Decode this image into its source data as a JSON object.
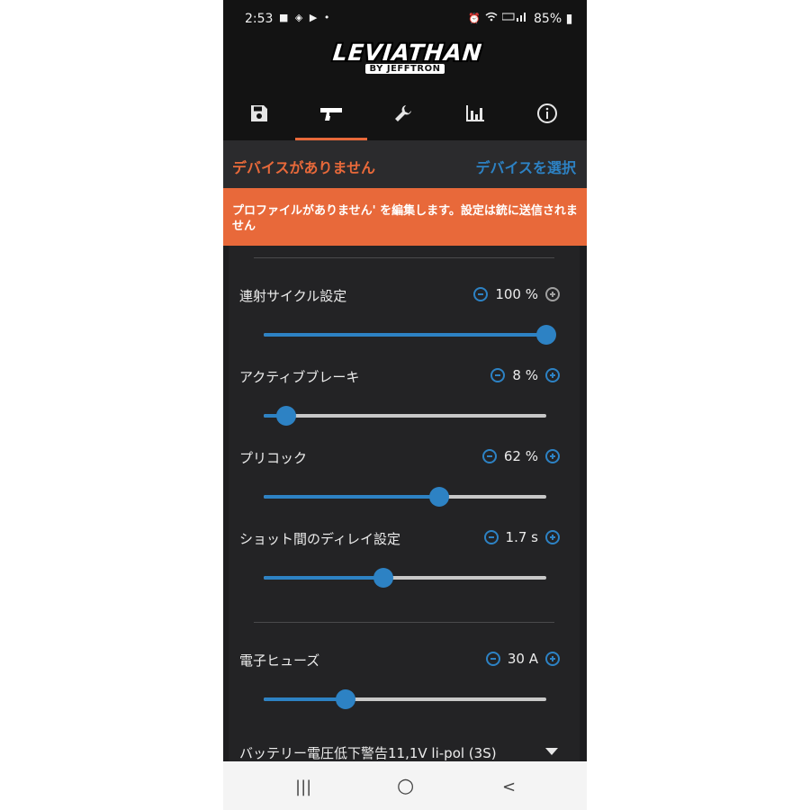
{
  "status_bar": {
    "time": "2:53",
    "battery": "85%",
    "left_icons": [
      "shopping-bag-icon",
      "app-icon",
      "youtube-icon",
      "dot"
    ],
    "right_icons": [
      "alarm-icon",
      "wifi-icon",
      "volte-icon",
      "signal-icon"
    ]
  },
  "app": {
    "logo_main": "LEVIATHAN",
    "logo_sub": "BY JEFFTRON"
  },
  "tabs": [
    {
      "icon": "save-icon",
      "active": false
    },
    {
      "icon": "gun-icon",
      "active": true
    },
    {
      "icon": "wrench-icon",
      "active": false
    },
    {
      "icon": "bar-chart-icon",
      "active": false
    },
    {
      "icon": "info-icon",
      "active": false
    }
  ],
  "device": {
    "status": "デバイスがありません",
    "select_label": "デバイスを選択"
  },
  "banner": {
    "message": "プロファイルがありません' を編集します。設定は銃に送信されません"
  },
  "settings": [
    {
      "label": "連射サイクル設定",
      "value": "100 %",
      "fraction": 1.0
    },
    {
      "label": "アクティブブレーキ",
      "value": "8 %",
      "fraction": 0.08
    },
    {
      "label": "プリコック",
      "value": "62 %",
      "fraction": 0.62
    },
    {
      "label": "ショット間のディレイ設定",
      "value": "1.7 s",
      "fraction": 0.425
    },
    {
      "label": "電子ヒューズ",
      "value": "30 A",
      "fraction": 0.29
    }
  ],
  "battery_warning": {
    "label": "バッテリー電圧低下警告11,1V li-pol (3S)"
  },
  "colors": {
    "accent_orange": "#e8693a",
    "accent_blue": "#2d82c4",
    "background": "#1d1d1f"
  },
  "nav_bar": {
    "recent": "|||",
    "home": "○",
    "back": "<"
  }
}
